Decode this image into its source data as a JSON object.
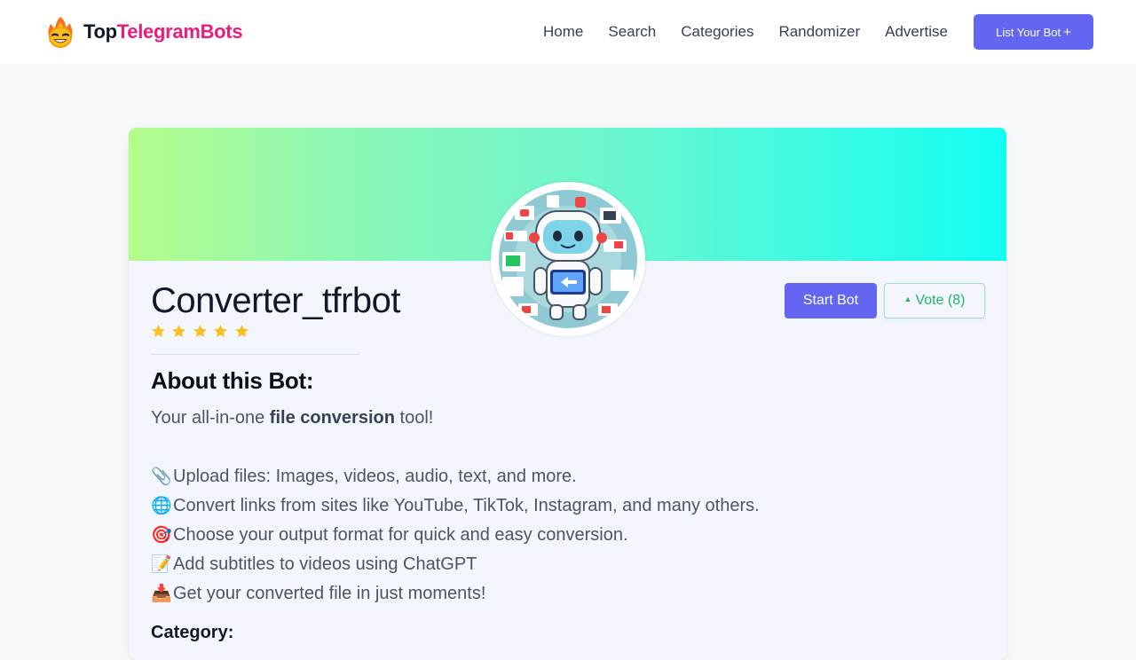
{
  "site": {
    "logo_part1": "Top",
    "logo_part2": "TelegramBots"
  },
  "nav": {
    "items": [
      {
        "label": "Home"
      },
      {
        "label": "Search"
      },
      {
        "label": "Categories"
      },
      {
        "label": "Randomizer"
      },
      {
        "label": "Advertise"
      }
    ],
    "cta_label": "List Your Bot",
    "cta_icon": "plus-icon"
  },
  "bot": {
    "name": "Converter_tfrbot",
    "rating": 5,
    "start_label": "Start Bot",
    "vote_label": "Vote (8)"
  },
  "about": {
    "title": "About this Bot:",
    "intro_prefix": "Your all-in-one ",
    "intro_bold": "file conversion",
    "intro_suffix": " tool!",
    "features": [
      {
        "emoji": "📎",
        "text": "Upload files: Images, videos, audio, text, and more."
      },
      {
        "emoji": "🌐",
        "text": "Convert links from sites like YouTube, TikTok, Instagram, and many others."
      },
      {
        "emoji": "🎯",
        "text": "Choose your output format for quick and easy conversion."
      },
      {
        "emoji": "📝",
        "text": "Add subtitles to videos using ChatGPT"
      },
      {
        "emoji": "📥",
        "text": "Get your converted file in just moments!"
      }
    ],
    "category_label": "Category:"
  },
  "colors": {
    "accent": "#6366f1",
    "brand_pink": "#ec1d7a",
    "vote_green": "#22b36b",
    "star": "#fbbf24"
  }
}
